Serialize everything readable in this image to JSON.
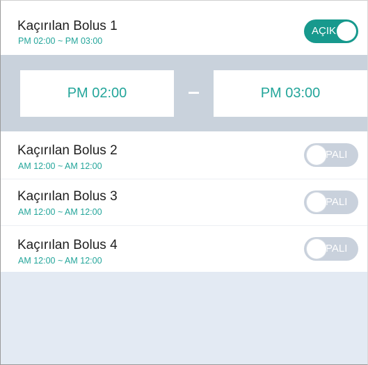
{
  "colors": {
    "accent": "#17998d",
    "accent_text": "#23a59a",
    "toggle_off": "#c9d1dc",
    "panel": "#c9d2dc",
    "background": "#e3eaf3"
  },
  "boluses": [
    {
      "title": "Kaçırılan Bolus 1",
      "range": "PM 02:00 ~ PM 03:00",
      "toggle_label": "AÇIK",
      "enabled": true
    },
    {
      "title": "Kaçırılan Bolus 2",
      "range": "AM 12:00 ~ AM 12:00",
      "toggle_label": "PALI",
      "enabled": false
    },
    {
      "title": "Kaçırılan Bolus 3",
      "range": "AM 12:00 ~ AM 12:00",
      "toggle_label": "PALI",
      "enabled": false
    },
    {
      "title": "Kaçırılan Bolus 4",
      "range": "AM 12:00 ~ AM 12:00",
      "toggle_label": "PALI",
      "enabled": false
    }
  ],
  "time_editor": {
    "start": "PM 02:00",
    "end": "PM 03:00"
  }
}
